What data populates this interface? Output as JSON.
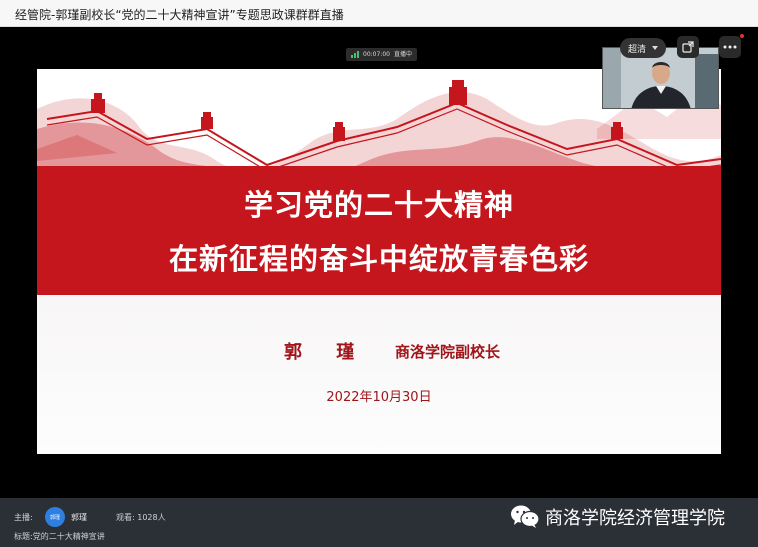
{
  "window": {
    "title": "经管院-郭瑾副校长“党的二十大精神宣讲”专题思政课群群直播"
  },
  "live_status": {
    "time": "00:07:00",
    "state": "直播中"
  },
  "controls": {
    "quality_label": "超清",
    "pip_icon": "picture-in-picture-icon",
    "more_icon": "more-icon"
  },
  "slide": {
    "title_line1": "学习党的二十大精神",
    "title_line2": "在新征程的奋斗中绽放青春色彩",
    "speaker": "郭 瑾",
    "speaker_role": "商洛学院副校长",
    "date": "2022年10月30日",
    "colors": {
      "banner": "#c4161c",
      "text": "#a0151a"
    }
  },
  "footer": {
    "host_label": "主播:",
    "host_avatar_text": "郭瑾",
    "host_name": "郭瑾",
    "viewers_label": "观看:",
    "viewers_count": "1028人",
    "subject_label": "标题:",
    "subject": "党的二十大精神宣讲",
    "watermark": "商洛学院经济管理学院"
  }
}
